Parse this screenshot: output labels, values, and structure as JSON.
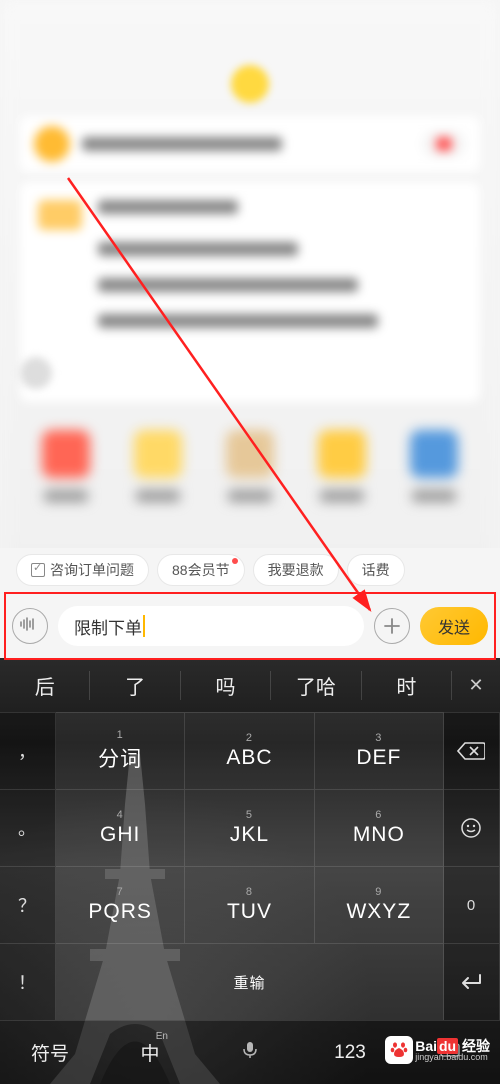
{
  "quick_replies": {
    "chip1": "咨询订单问题",
    "chip2": "88会员节",
    "chip3": "我要退款",
    "chip4": "话费"
  },
  "input": {
    "value": "限制下单",
    "send_label": "发送"
  },
  "keyboard": {
    "suggestions": [
      "后",
      "了",
      "吗",
      "了哈",
      "时"
    ],
    "close": "✕",
    "side_left": [
      "，",
      "。",
      "？",
      "！"
    ],
    "side_right_backspace": "⌫",
    "side_right_reinput": "重输",
    "side_right_zero": "0",
    "keys": [
      {
        "label": "分词",
        "num": "1"
      },
      {
        "label": "ABC",
        "num": "2"
      },
      {
        "label": "DEF",
        "num": "3"
      },
      {
        "label": "GHI",
        "num": "4"
      },
      {
        "label": "JKL",
        "num": "5"
      },
      {
        "label": "MNO",
        "num": "6"
      },
      {
        "label": "PQRS",
        "num": "7"
      },
      {
        "label": "TUV",
        "num": "8"
      },
      {
        "label": "WXYZ",
        "num": "9"
      }
    ],
    "bottom": {
      "symbol": "符号",
      "lang": "中",
      "lang_sup": "En",
      "num": "123"
    }
  },
  "watermark": {
    "brand_a": "Bai",
    "brand_b": "du",
    "brand_c": "经验",
    "url": "jingyan.baidu.com"
  }
}
